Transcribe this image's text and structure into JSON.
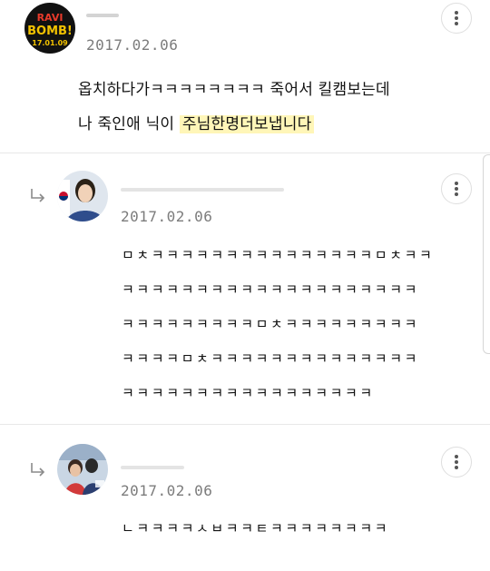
{
  "comments": [
    {
      "avatar_label_line1": "RAVI",
      "avatar_label_line2": "BOMB!",
      "avatar_label_line3": "17.01.09",
      "date": "2017.02.06",
      "body_line1": "옵치하다가ㅋㅋㅋㅋㅋㅋㅋㅋ 죽어서 킬캠보는데",
      "body_line2_plain": "나 죽인애 닉이 ",
      "body_line2_highlight": "주님한명더보냅니다"
    },
    {
      "date": "2017.02.06",
      "lines": [
        "ㅁㅊㅋㅋㅋㅋㅋㅋㅋㅋㅋㅋㅋㅋㅋㅋㅋㅁㅊㅋㅋ",
        "ㅋㅋㅋㅋㅋㅋㅋㅋㅋㅋㅋㅋㅋㅋㅋㅋㅋㅋㅋㅋ",
        "ㅋㅋㅋㅋㅋㅋㅋㅋㅋㅁㅊㅋㅋㅋㅋㅋㅋㅋㅋㅋ",
        "ㅋㅋㅋㅋㅁㅊㅋㅋㅋㅋㅋㅋㅋㅋㅋㅋㅋㅋㅋㅋ",
        "ㅋㅋㅋㅋㅋㅋㅋㅋㅋㅋㅋㅋㅋㅋㅋㅋㅋ"
      ]
    },
    {
      "date": "2017.02.06",
      "lines": [
        "ㄴㅋㅋㅋㅋㅅㅂㅋㅋㅌㅋㅋㅋㅋㅋㅋㅋㅋ"
      ]
    }
  ],
  "colors": {
    "highlight": "#fff6b8",
    "date": "#7c7c7c",
    "divider": "#e8e8e8"
  },
  "icons": {
    "more": "more-vertical-icon",
    "reply": "reply-arrow-icon"
  }
}
